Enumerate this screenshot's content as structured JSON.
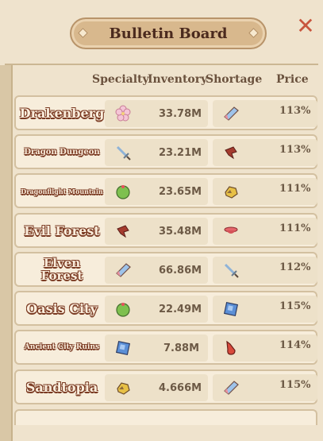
{
  "title": "Bulletin Board",
  "columns": {
    "specialty": "Specialty",
    "inventory": "Inventory",
    "shortage": "Shortage",
    "price": "Price"
  },
  "rows": [
    {
      "name": "Drakenberg",
      "specialty_icon": "flower-icon",
      "inventory": "33.78M",
      "shortage_icon": "crystal-icon",
      "price": "113%"
    },
    {
      "name": "Dragon Dungeon",
      "specialty_icon": "sword-icon",
      "inventory": "23.21M",
      "shortage_icon": "dragon-head-icon",
      "price": "113%"
    },
    {
      "name": "Dragonflight Mountain",
      "specialty_icon": "cactus-icon",
      "inventory": "23.65M",
      "shortage_icon": "ore-icon",
      "price": "111%"
    },
    {
      "name": "Evil Forest",
      "specialty_icon": "dragon-head-icon",
      "inventory": "35.48M",
      "shortage_icon": "bowl-icon",
      "price": "111%"
    },
    {
      "name": "Elven Forest",
      "specialty_icon": "crystal-icon",
      "inventory": "66.86M",
      "shortage_icon": "sword-icon",
      "price": "112%"
    },
    {
      "name": "Oasis City",
      "specialty_icon": "cactus-icon",
      "inventory": "22.49M",
      "shortage_icon": "blue-gem-icon",
      "price": "115%"
    },
    {
      "name": "Ancient City Ruins",
      "specialty_icon": "blue-gem-icon",
      "inventory": "7.88M",
      "shortage_icon": "red-claw-icon",
      "price": "114%"
    },
    {
      "name": "Sandtopia",
      "specialty_icon": "ore-icon",
      "inventory": "4.666M",
      "shortage_icon": "crystal-icon",
      "price": "115%"
    }
  ]
}
